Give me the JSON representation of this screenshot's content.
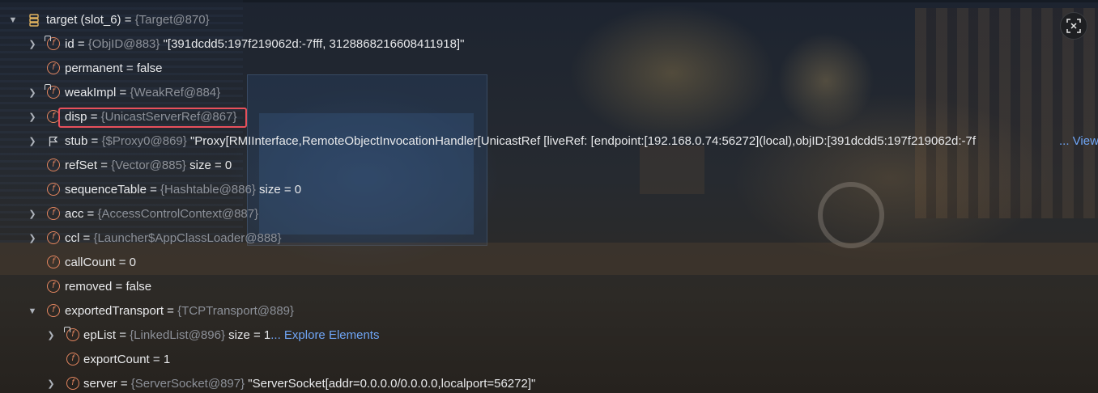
{
  "colors": {
    "accent_link": "#6fa5f5",
    "field_icon": "#e2855f",
    "highlight_box": "#e8505b",
    "type_text": "#8c9098"
  },
  "corner_button": {
    "icon": "close-fullscreen-icon"
  },
  "tree": {
    "root": {
      "name": "target (slot_6)",
      "eq": " = ",
      "type": "{Target@870}",
      "expanded": true,
      "icon": "struct-icon"
    },
    "rows": [
      {
        "name": "id",
        "eq": " = ",
        "type": "{ObjID@883}",
        "value": " \"[391dcdd5:197f219062d:-7fff, 3128868216608411918]\"",
        "expandable": true,
        "icon": "field-lock-icon"
      },
      {
        "name": "permanent",
        "eq": " = ",
        "type": "",
        "value": "false",
        "expandable": false,
        "icon": "field-icon"
      },
      {
        "name": "weakImpl",
        "eq": " = ",
        "type": "{WeakRef@884}",
        "value": "",
        "expandable": true,
        "icon": "field-lock-icon"
      },
      {
        "name": "disp",
        "eq": " = ",
        "type": "{UnicastServerRef@867}",
        "value": "",
        "expandable": true,
        "icon": "field-icon",
        "highlighted": true
      },
      {
        "name": "stub",
        "eq": " = ",
        "type": "{$Proxy0@869}",
        "value": " \"Proxy[RMIInterface,RemoteObjectInvocationHandler[UnicastRef [liveRef: [endpoint:[192.168.0.74:56272](local),objID:[391dcdd5:197f219062d:-7f",
        "link": "... View",
        "expandable": true,
        "icon": "flag-icon"
      },
      {
        "name": "refSet",
        "eq": " = ",
        "type": "{Vector@885}",
        "value": "  size = 0",
        "expandable": false,
        "icon": "field-icon"
      },
      {
        "name": "sequenceTable",
        "eq": " = ",
        "type": "{Hashtable@886}",
        "value": "  size = 0",
        "expandable": false,
        "icon": "field-icon"
      },
      {
        "name": "acc",
        "eq": " = ",
        "type": "{AccessControlContext@887}",
        "value": "",
        "expandable": true,
        "icon": "field-icon"
      },
      {
        "name": "ccl",
        "eq": " = ",
        "type": "{Launcher$AppClassLoader@888}",
        "value": "",
        "expandable": true,
        "icon": "field-icon"
      },
      {
        "name": "callCount",
        "eq": " = ",
        "type": "",
        "value": "0",
        "expandable": false,
        "icon": "field-icon"
      },
      {
        "name": "removed",
        "eq": " = ",
        "type": "",
        "value": "false",
        "expandable": false,
        "icon": "field-icon"
      },
      {
        "name": "exportedTransport",
        "eq": " = ",
        "type": "{TCPTransport@889}",
        "value": "",
        "expandable": true,
        "expanded": true,
        "icon": "field-icon"
      }
    ],
    "children": [
      {
        "name": "epList",
        "eq": " = ",
        "type": "{LinkedList@896}",
        "value": "  size = 1",
        "link": "... Explore Elements",
        "expandable": true,
        "icon": "field-lock-icon"
      },
      {
        "name": "exportCount",
        "eq": " = ",
        "type": "",
        "value": "1",
        "expandable": false,
        "icon": "field-icon"
      },
      {
        "name": "server",
        "eq": " = ",
        "type": "{ServerSocket@897}",
        "value": " \"ServerSocket[addr=0.0.0.0/0.0.0.0,localport=56272]\"",
        "expandable": true,
        "icon": "field-icon"
      }
    ]
  }
}
